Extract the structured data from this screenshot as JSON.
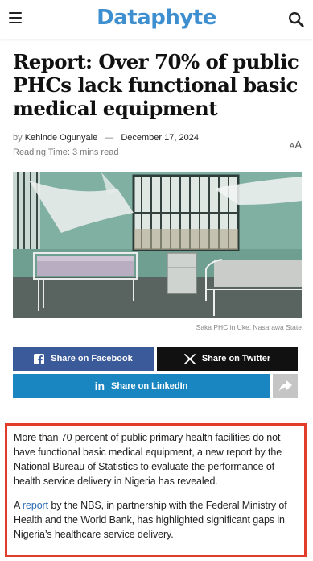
{
  "header": {
    "logo": "Dataphyte",
    "menu_icon": "hamburger-icon",
    "search_icon": "search-icon"
  },
  "article": {
    "title": "Report: Over 70% of public PHCs lack functional basic medical equipment",
    "by_label": "by",
    "author": "Kehinde Ogunyale",
    "separator": "—",
    "date": "December 17, 2024",
    "reading_time": "Reading Time: 3 mins read",
    "text_size_label": "AA",
    "image_caption": "Saka PHC in Uke, Nasarawa State",
    "paragraph1": "More than 70 percent of public primary health facilities do not have functional basic medical equipment, a new report by the National Bureau of Statistics to evaluate the performance of health service delivery in Nigeria has revealed.",
    "paragraph2_prefix": "A ",
    "paragraph2_link": "report",
    "paragraph2_rest": " by the NBS, in partnership with the Federal Ministry of Health and the World Bank, has highlighted significant gaps in Nigeria’s healthcare service delivery."
  },
  "share": {
    "facebook": "Share on Facebook",
    "twitter": "Share on Twitter",
    "linkedin": "Share on LinkedIn"
  },
  "colors": {
    "brand": "#3d8fd0",
    "facebook": "#3b5a9a",
    "twitter": "#111111",
    "linkedin": "#1a86c1",
    "highlight_border": "#e23c2a"
  }
}
